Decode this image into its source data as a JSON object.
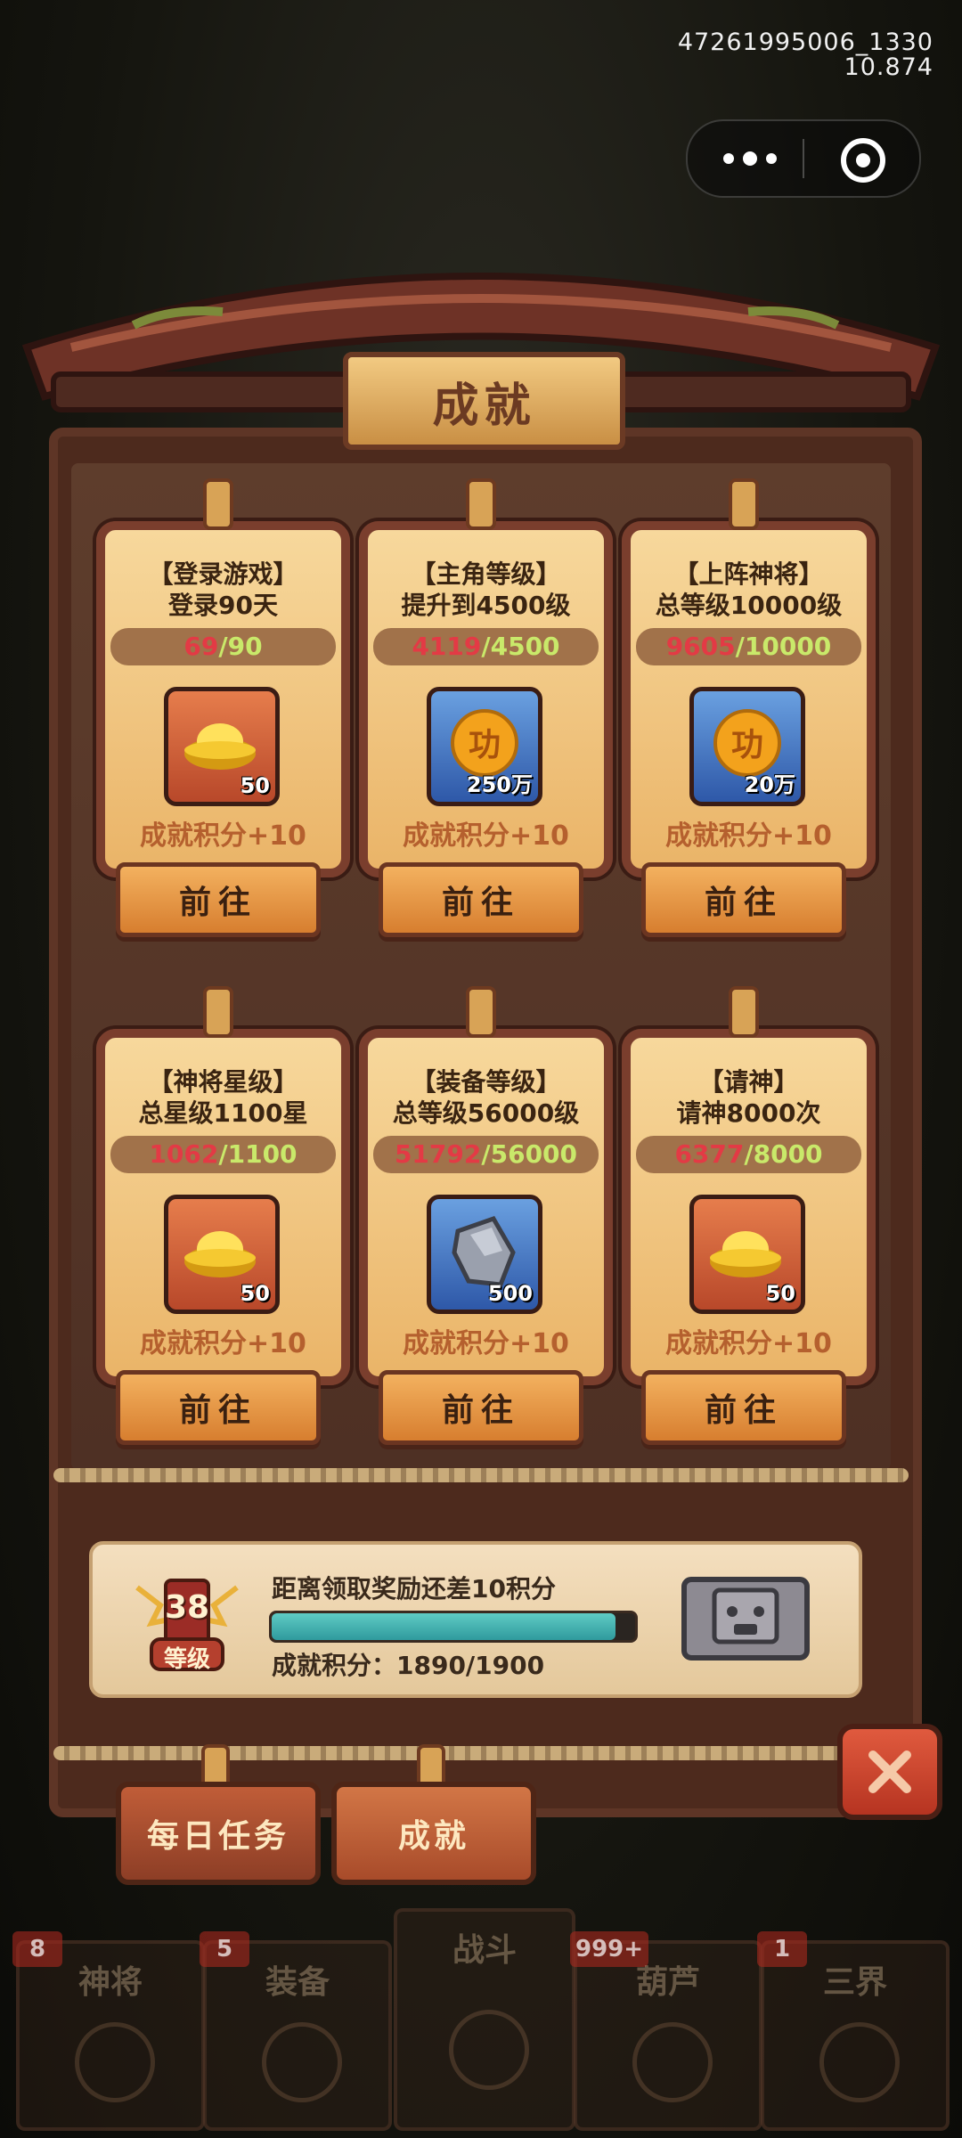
{
  "system": {
    "id_line1": "47261995006_1330",
    "id_line2": "10.874"
  },
  "capsule": {
    "more_icon": "ellipsis-icon",
    "close_icon": "target-icon"
  },
  "panel": {
    "title": "成就"
  },
  "achievements": [
    {
      "title": "【登录游戏】",
      "desc": "登录90天",
      "current": "69",
      "total": "90",
      "reward_type": "gold-ingot",
      "reward_amount": "50",
      "points": "成就积分+10",
      "button": "前往"
    },
    {
      "title": "【主角等级】",
      "desc": "提升到4500级",
      "current": "4119",
      "total": "4500",
      "reward_type": "merit-coin",
      "reward_amount": "250万",
      "points": "成就积分+10",
      "button": "前往"
    },
    {
      "title": "【上阵神将】",
      "desc": "总等级10000级",
      "current": "9605",
      "total": "10000",
      "reward_type": "merit-coin",
      "reward_amount": "20万",
      "points": "成就积分+10",
      "button": "前往"
    },
    {
      "title": "【神将星级】",
      "desc": "总星级1100星",
      "current": "1062",
      "total": "1100",
      "reward_type": "gold-ingot",
      "reward_amount": "50",
      "points": "成就积分+10",
      "button": "前往"
    },
    {
      "title": "【装备等级】",
      "desc": "总等级56000级",
      "current": "51792",
      "total": "56000",
      "reward_type": "stone",
      "reward_amount": "500",
      "points": "成就积分+10",
      "button": "前往"
    },
    {
      "title": "【请神】",
      "desc": "请神8000次",
      "current": "6377",
      "total": "8000",
      "reward_type": "gold-ingot",
      "reward_amount": "50",
      "points": "成就积分+10",
      "button": "前往"
    }
  ],
  "reward": {
    "level": "38",
    "level_label": "等级",
    "message": "距离领取奖励还差10积分",
    "progress_fraction": 0.947,
    "score_text": "成就积分：1890/1900"
  },
  "tabs": [
    {
      "label": "每日任务",
      "active": false
    },
    {
      "label": "成就",
      "active": true
    }
  ],
  "nav": [
    {
      "label": "神将",
      "badge": "8"
    },
    {
      "label": "装备",
      "badge": "5"
    },
    {
      "label": "战斗",
      "badge": ""
    },
    {
      "label": "葫芦",
      "badge": "999+"
    },
    {
      "label": "三界",
      "badge": "1"
    }
  ],
  "colors": {
    "progress_current": "#e33a45",
    "progress_total": "#c9e96a",
    "bar_fill": "#3fb0ad"
  }
}
